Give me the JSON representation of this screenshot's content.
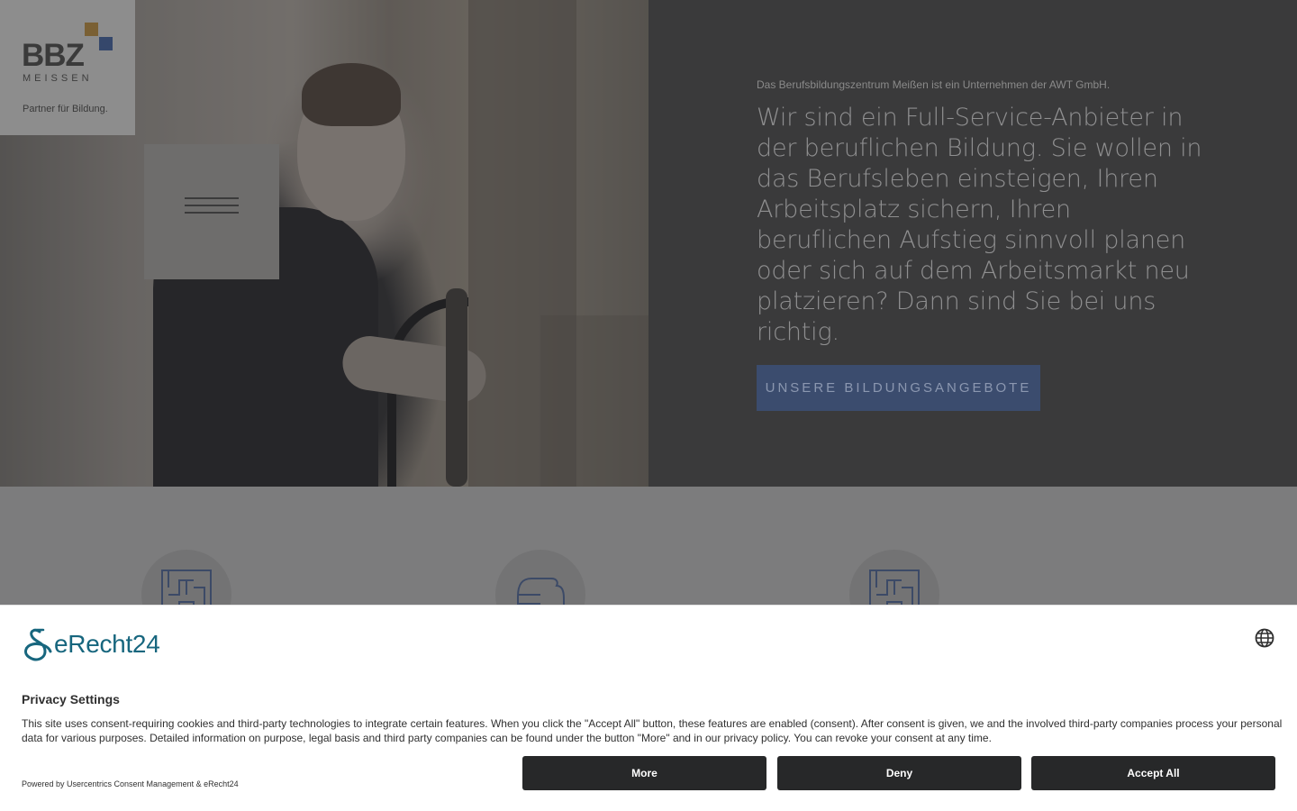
{
  "logo": {
    "wordmark": "BBZ",
    "subline": "MEISSEN",
    "claim": "Partner für Bildung."
  },
  "hero": {
    "kicker": "Das Berufsbildungszentrum Meißen ist ein Unternehmen der AWT GmbH.",
    "headline": "Wir sind ein Full-Service-Anbieter in der beruflichen Bildung. Sie wollen in das Berufsleben einsteigen, Ihren Arbeitsplatz sichern, Ihren beruflichen Aufstieg sinnvoll planen oder sich auf dem Arbeitsmarkt neu platzieren? Dann sind Sie bei uns richtig.",
    "cta_label": "UNSERE BILDUNGSANGEBOTE"
  },
  "features": {
    "icons": [
      "maze-icon",
      "fist-icon",
      "maze-icon"
    ]
  },
  "consent": {
    "brand": "eRecht24",
    "title": "Privacy Settings",
    "description": "This site uses consent-requiring cookies and third-party technologies to integrate certain features. When you click the \"Accept All\" button, these features are enabled (consent). After consent is given, we and the involved third-party companies process your personal data for various purposes. Detailed information on purpose, legal basis and third party companies can be found under the button \"More\" and in our privacy policy. You can revoke your consent at any time.",
    "powered_by": "Powered by Usercentrics Consent Management & eRecht24",
    "buttons": {
      "more": "More",
      "deny": "Deny",
      "accept": "Accept All"
    }
  },
  "colors": {
    "accent_blue": "#35476b",
    "accent_gold": "#7a6034",
    "brand_teal": "#17667e",
    "button_dark": "#272829"
  }
}
